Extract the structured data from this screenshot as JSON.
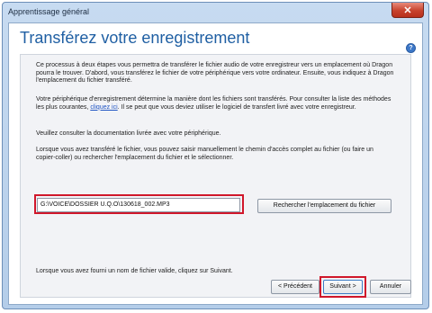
{
  "window": {
    "title": "Apprentissage général",
    "close_symbol": "✕"
  },
  "main": {
    "heading": "Transférez votre enregistrement",
    "help_symbol": "?",
    "paragraph1": "Ce processus à deux étapes vous permettra de transférer le fichier audio de votre enregistreur vers un emplacement où Dragon pourra le trouver. D'abord, vous transférez le fichier de votre périphérique vers votre ordinateur. Ensuite, vous indiquez à Dragon l'emplacement du fichier transféré.",
    "paragraph2_before_link": "Votre périphérique d'enregistrement détermine la manière dont les fichiers sont transférés. Pour consulter la liste des méthodes les plus courantes, ",
    "paragraph2_link": "cliquez ici",
    "paragraph2_after_link": ". Il se peut que vous deviez utiliser le logiciel de transfert livré avec votre enregistreur.",
    "paragraph3": "Veuillez consulter la documentation livrée avec votre périphérique.",
    "paragraph4": "Lorsque vous avez transféré le fichier, vous pouvez saisir manuellement le chemin d'accès complet au fichier (ou faire un copier-coller) ou rechercher l'emplacement du fichier et le sélectionner.",
    "file_path_value": "G:\\VOICE\\DOSSIER U.Q.O\\130618_002.MP3",
    "browse_button": "Rechercher l'emplacement du fichier",
    "paragraph5": "Lorsque vous avez fourni un nom de fichier valide, cliquez sur Suivant."
  },
  "footer": {
    "previous_button": "< Précédent",
    "next_button": "Suivant >",
    "cancel_button": "Annuler"
  }
}
